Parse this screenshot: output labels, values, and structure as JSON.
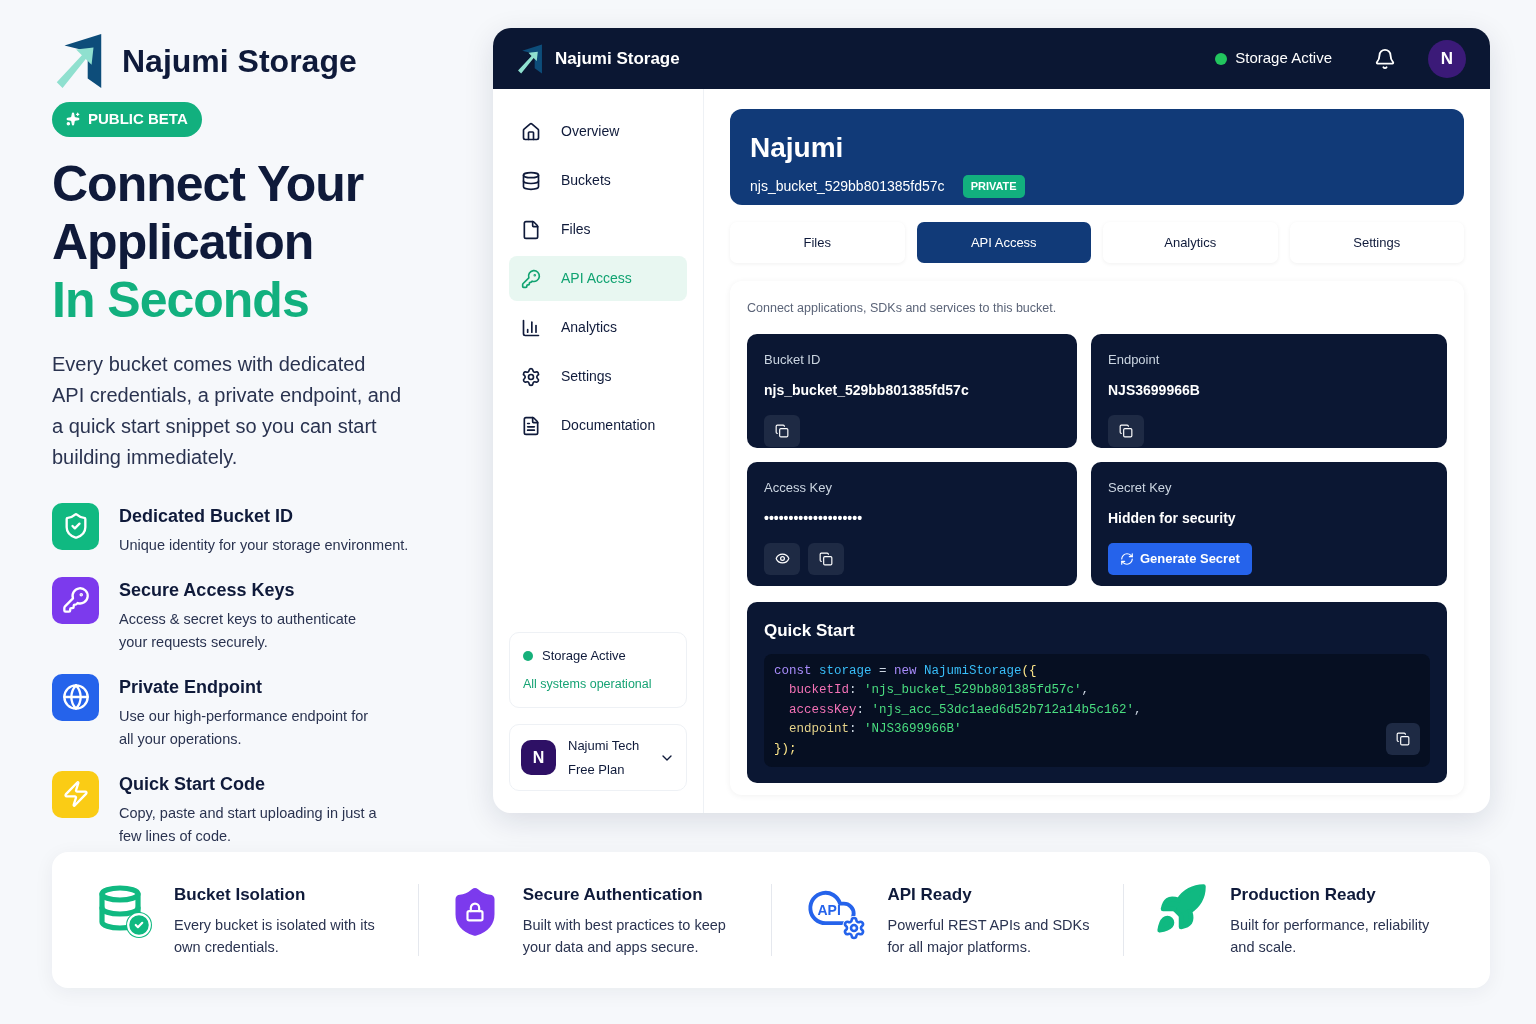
{
  "brand": {
    "name": "Najumi Storage",
    "badge": "PUBLIC BETA"
  },
  "hero": {
    "title_lines": [
      "Connect Your",
      "Application"
    ],
    "accent_line": "In Seconds",
    "description": "Every bucket comes with dedicated API credentials, a private endpoint, and a quick start snippet so you can start building immediately."
  },
  "features": [
    {
      "kind": "shield",
      "title": "Dedicated Bucket ID",
      "text": "Unique identity for your storage environment."
    },
    {
      "kind": "key",
      "title": "Secure Access Keys",
      "text": "Access & secret keys to authenticate your requests securely."
    },
    {
      "kind": "globe",
      "title": "Private Endpoint",
      "text": "Use our high-performance endpoint for all your operations."
    },
    {
      "kind": "bolt",
      "title": "Quick Start Code",
      "text": "Copy, paste and start uploading in just a few lines of code."
    }
  ],
  "app": {
    "title": "Najumi Storage",
    "status": "Storage Active",
    "avatar": "N",
    "sidebar": {
      "items": [
        {
          "kind": "home",
          "label": "Overview",
          "selected": false
        },
        {
          "kind": "database",
          "label": "Buckets",
          "selected": false
        },
        {
          "kind": "file",
          "label": "Files",
          "selected": false
        },
        {
          "kind": "key",
          "label": "API Access",
          "selected": true
        },
        {
          "kind": "chart",
          "label": "Analytics",
          "selected": false
        },
        {
          "kind": "gear",
          "label": "Settings",
          "selected": false
        },
        {
          "kind": "doc",
          "label": "Documentation",
          "selected": false
        }
      ],
      "status": {
        "title": "Storage Active",
        "text": "All systems operational"
      },
      "account": {
        "avatar": "N",
        "name": "Najumi Tech",
        "plan": "Free Plan"
      }
    },
    "bucket": {
      "name": "Najumi",
      "id": "njs_bucket_529bb801385fd57c",
      "badge": "PRIVATE"
    },
    "tabs": [
      {
        "label": "Files",
        "selected": false
      },
      {
        "label": "API Access",
        "selected": true
      },
      {
        "label": "Analytics",
        "selected": false
      },
      {
        "label": "Settings",
        "selected": false
      }
    ],
    "intro": "Connect applications, SDKs and services to this bucket.",
    "credentials": [
      {
        "kind": "copy",
        "label": "Bucket ID",
        "value": "njs_bucket_529bb801385fd57c"
      },
      {
        "kind": "copy",
        "label": "Endpoint",
        "value": "NJS3699966B"
      },
      {
        "kind": "masked",
        "label": "Access Key",
        "value": "••••••••••••••••••••"
      },
      {
        "kind": "secret",
        "label": "Secret Key",
        "value": "Hidden for security",
        "action": "Generate Secret"
      }
    ],
    "quick_start": {
      "title": "Quick Start",
      "lines": [
        [
          {
            "kind": "keyword",
            "text": "const "
          },
          {
            "kind": "name",
            "text": "storage"
          },
          {
            "kind": "plain",
            "text": " = "
          },
          {
            "kind": "keyword",
            "text": "new "
          },
          {
            "kind": "name",
            "text": "NajumiStorage"
          },
          {
            "kind": "punct",
            "text": "({"
          }
        ],
        [
          {
            "kind": "prop",
            "text": "  bucketId"
          },
          {
            "kind": "plain",
            "text": ": "
          },
          {
            "kind": "string",
            "text": "'njs_bucket_529bb801385fd57c'"
          },
          {
            "kind": "plain",
            "text": ","
          }
        ],
        [
          {
            "kind": "prop",
            "text": "  accessKey"
          },
          {
            "kind": "plain",
            "text": ": "
          },
          {
            "kind": "string",
            "text": "'njs_acc_53dc1aed6d52b712a14b5c162'"
          },
          {
            "kind": "plain",
            "text": ","
          }
        ],
        [
          {
            "kind": "prop2",
            "text": "  endpoint"
          },
          {
            "kind": "plain",
            "text": ": "
          },
          {
            "kind": "string",
            "text": "'NJS3699966B'"
          }
        ],
        [
          {
            "kind": "punct",
            "text": "});"
          }
        ]
      ]
    }
  },
  "highlights": [
    {
      "kind": "database",
      "title": "Bucket Isolation",
      "text": "Every bucket is isolated with its own credentials."
    },
    {
      "kind": "lock",
      "title": "Secure Authentication",
      "text": "Built with best practices to keep your data and apps secure."
    },
    {
      "kind": "cloud",
      "icon_label": "API",
      "title": "API Ready",
      "text": "Powerful REST APIs and SDKs for all major platforms."
    },
    {
      "kind": "rocket",
      "title": "Production Ready",
      "text": "Built for performance, reliability and scale."
    }
  ]
}
